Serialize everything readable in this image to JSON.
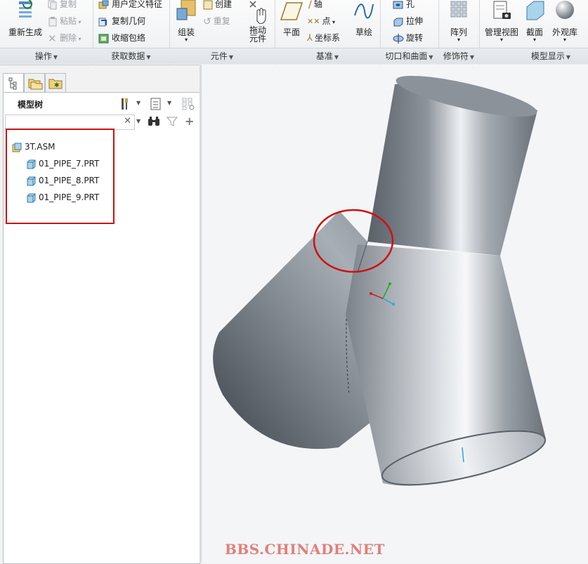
{
  "ribbon": {
    "operations": {
      "group_label": "操作",
      "regenerate": "重新生成",
      "copy": "复制",
      "paste": "粘贴",
      "delete": "删除"
    },
    "get_data": {
      "group_label": "获取数据",
      "udf": "用户定义特征",
      "copy_geom": "复制几何",
      "shrinkwrap": "收缩包络"
    },
    "component": {
      "group_label": "元件",
      "assemble": "组装",
      "create": "创建",
      "repeat": "重复",
      "drag_components": "拖动\n元件"
    },
    "datum": {
      "group_label": "基准",
      "plane": "平面",
      "axis": "轴",
      "point": "点",
      "csys": "坐标系",
      "sketch": "草绘"
    },
    "cut_surface": {
      "group_label": "切口和曲面",
      "hole": "孔",
      "extrude": "拉伸",
      "revolve": "旋转"
    },
    "modifiers": {
      "group_label": "修饰符",
      "pattern": "阵列"
    },
    "model_display": {
      "group_label": "模型显示",
      "manage_views": "管理视图",
      "section": "截面",
      "appearance": "外观库"
    }
  },
  "model_tree": {
    "title": "模型树",
    "search_value": "",
    "items": [
      {
        "label": "3T.ASM",
        "type": "assembly"
      },
      {
        "label": "01_PIPE_7.PRT",
        "type": "part"
      },
      {
        "label": "01_PIPE_8.PRT",
        "type": "part"
      },
      {
        "label": "01_PIPE_9.PRT",
        "type": "part"
      }
    ]
  },
  "watermark": "BBS.CHINADE.NET",
  "colors": {
    "highlight_red": "#d01010",
    "pipe_gray": "#8d939b",
    "watermark": "#e0807a"
  }
}
